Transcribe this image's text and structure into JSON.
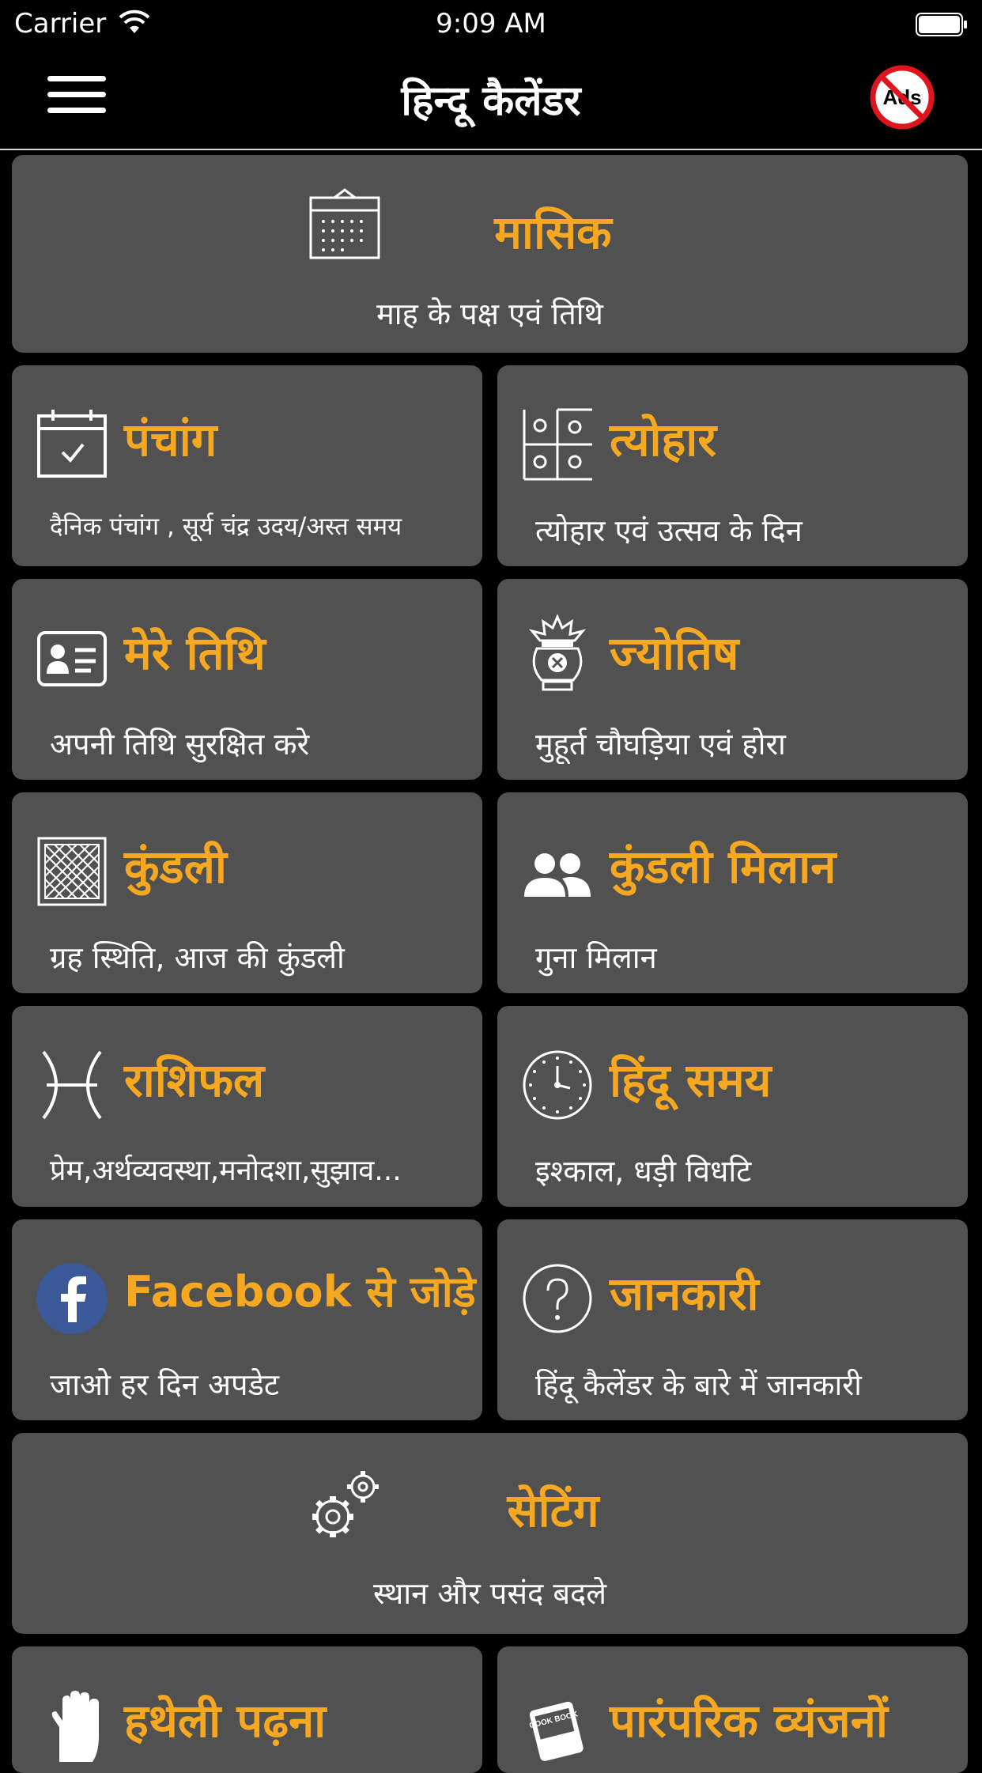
{
  "status_bar": {
    "carrier": "Carrier",
    "time": "9:09 AM"
  },
  "nav": {
    "title": "हिन्दू कैलेंडर",
    "ads_badge": "Ads"
  },
  "tiles": {
    "masik": {
      "title": "मासिक",
      "subtitle": "माह के पक्ष एवं तिथि"
    },
    "panchang": {
      "title": "पंचांग",
      "subtitle": "दैनिक पंचांग , सूर्य चंद्र उदय/अस्त समय"
    },
    "tyohar": {
      "title": "त्योहार",
      "subtitle": "त्योहार एवं उत्सव के दिन"
    },
    "mere_tithi": {
      "title": "मेरे तिथि",
      "subtitle": "अपनी तिथि सुरक्षित करे"
    },
    "jyotish": {
      "title": "ज्योतिष",
      "subtitle": "मुहूर्त चौघड़िया एवं होरा"
    },
    "kundli": {
      "title": "कुंडली",
      "subtitle": "ग्रह स्थिति, आज की कुंडली"
    },
    "kundli_milan": {
      "title": "कुंडली मिलान",
      "subtitle": "गुना मिलान"
    },
    "rashifal": {
      "title": "राशिफल",
      "subtitle": "प्रेम,अर्थव्यवस्था,मनोदशा,सुझाव..."
    },
    "hindu_samay": {
      "title": "हिंदू समय",
      "subtitle": "इश्काल, धड़ी विधटि"
    },
    "facebook": {
      "title": "Facebook से जोड़े",
      "subtitle": "जाओ हर दिन अपडेट"
    },
    "jankari": {
      "title": "जानकारी",
      "subtitle": "हिंदू कैलेंडर के बारे में जानकारी"
    },
    "setting": {
      "title": "सेटिंग",
      "subtitle": "स्थान और पसंद बदले"
    },
    "hatheli": {
      "title": "हथेली पढ़ना"
    },
    "vyanjan": {
      "title": "पारंपरिक व्यंजनों",
      "book_text": "COOK BOOK"
    }
  },
  "colors": {
    "accent": "#f6a821",
    "tile_bg": "#515151",
    "facebook": "#3b5998"
  }
}
